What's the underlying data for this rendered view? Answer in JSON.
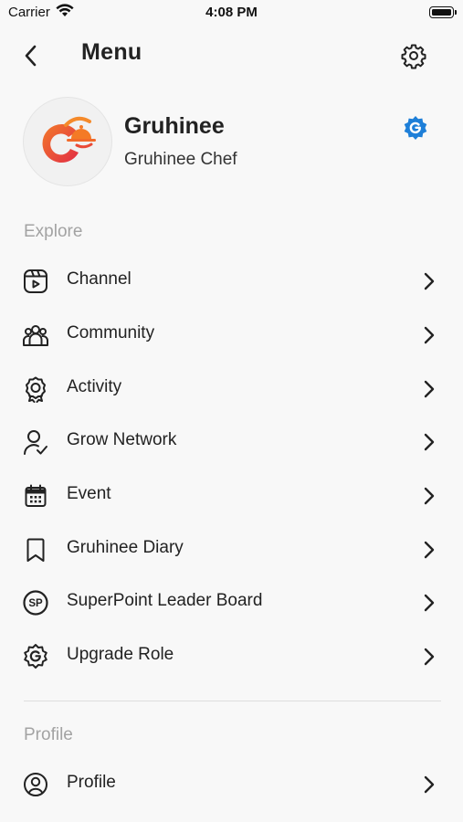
{
  "status_bar": {
    "carrier": "Carrier",
    "time": "4:08 PM"
  },
  "header": {
    "title": "Menu"
  },
  "profile": {
    "name": "Gruhinee",
    "role": "Gruhinee Chef"
  },
  "sections": {
    "explore": "Explore",
    "profile": "Profile"
  },
  "menu": [
    {
      "label": "Channel",
      "icon": "channel-video-icon"
    },
    {
      "label": "Community",
      "icon": "community-people-icon"
    },
    {
      "label": "Activity",
      "icon": "award-ribbon-icon"
    },
    {
      "label": "Grow Network",
      "icon": "user-check-icon"
    },
    {
      "label": "Event",
      "icon": "calendar-icon"
    },
    {
      "label": "Gruhinee Diary",
      "icon": "bookmark-icon"
    },
    {
      "label": "SuperPoint Leader Board",
      "icon": "sp-badge-icon"
    },
    {
      "label": "Upgrade Role",
      "icon": "upgrade-badge-icon"
    }
  ],
  "profile_menu": [
    {
      "label": "Profile",
      "icon": "user-circle-icon"
    }
  ],
  "colors": {
    "accent_blue": "#1e7fd8",
    "logo_orange": "#f0642a",
    "logo_red": "#e8343f"
  }
}
